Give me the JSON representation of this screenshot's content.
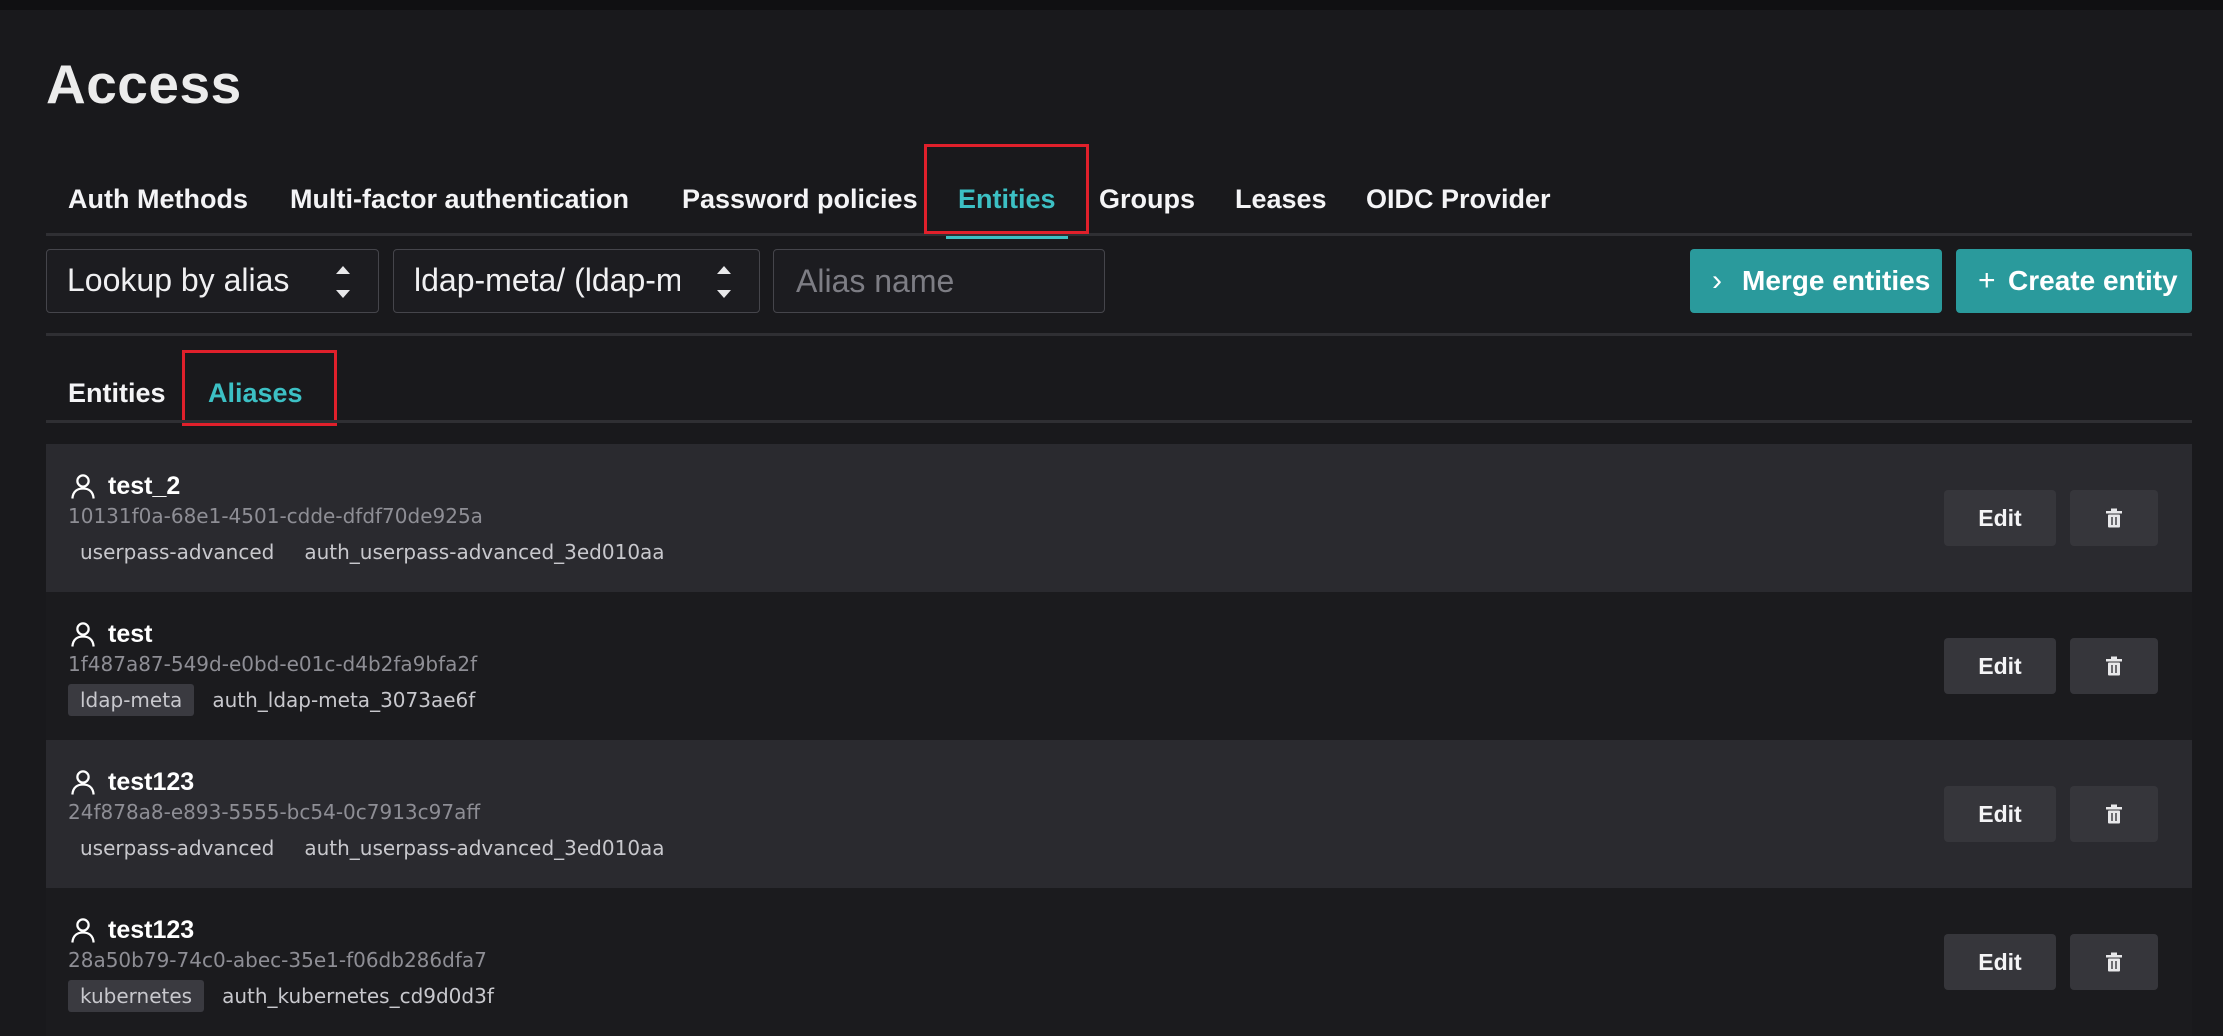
{
  "page": {
    "title": "Access"
  },
  "tabs": [
    {
      "label": "Auth Methods",
      "active": false
    },
    {
      "label": "Multi-factor authentication",
      "active": false
    },
    {
      "label": "Password policies",
      "active": false
    },
    {
      "label": "Entities",
      "active": true
    },
    {
      "label": "Groups",
      "active": false
    },
    {
      "label": "Leases",
      "active": false
    },
    {
      "label": "OIDC Provider",
      "active": false
    }
  ],
  "toolbar": {
    "lookup_select": {
      "value": "Lookup by alias",
      "icon": "select-arrows-icon"
    },
    "mount_select": {
      "value": "ldap-meta/ (ldap-meta)",
      "icon": "select-arrows-icon"
    },
    "alias_input": {
      "value": "",
      "placeholder": "Alias name"
    },
    "merge_button": {
      "label": "Merge entities",
      "icon": "chevron-right-icon",
      "glyph": "›"
    },
    "create_button": {
      "label": "Create entity",
      "icon": "plus-icon",
      "glyph": "+"
    }
  },
  "subtabs": [
    {
      "label": "Entities",
      "active": false
    },
    {
      "label": "Aliases",
      "active": true
    }
  ],
  "aliases": [
    {
      "name": "test_2",
      "id": "10131f0a-68e1-4501-cdde-dfdf70de925a",
      "mount_type": "userpass-advanced",
      "mount_accessor": "auth_userpass-advanced_3ed010aa"
    },
    {
      "name": "test",
      "id": "1f487a87-549d-e0bd-e01c-d4b2fa9bfa2f",
      "mount_type": "ldap-meta",
      "mount_accessor": "auth_ldap-meta_3073ae6f"
    },
    {
      "name": "test123",
      "id": "24f878a8-e893-5555-bc54-0c7913c97aff",
      "mount_type": "userpass-advanced",
      "mount_accessor": "auth_userpass-advanced_3ed010aa"
    },
    {
      "name": "test123",
      "id": "28a50b79-74c0-abec-35e1-f06db286dfa7",
      "mount_type": "kubernetes",
      "mount_accessor": "auth_kubernetes_cd9d0d3f"
    }
  ],
  "row_actions": {
    "edit_label": "Edit",
    "delete_icon": "trash-icon"
  },
  "colors": {
    "accent": "#3cc0c4",
    "primary_button": "#2a9a9c",
    "highlight_box": "#e0202b",
    "background": "#19191c"
  }
}
